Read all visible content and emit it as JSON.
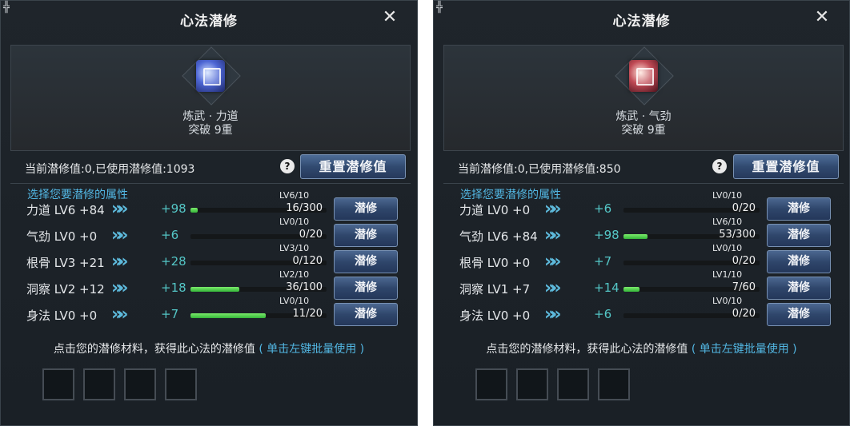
{
  "panels": [
    {
      "corner_glyph": "╬",
      "title": "心法潜修",
      "close_symbol": "✕",
      "skill_icon": "book-icon",
      "skill_icon_color": "#4d66d4",
      "skill_name": "炼武 · 力道",
      "skill_breakthrough": "突破 9重",
      "points_line": "当前潜修值:0,已使用潜修值:1093",
      "help_symbol": "?",
      "reset_label": "重置潜修值",
      "choose_label": "选择您要潜修的属性",
      "rows": [
        {
          "label": "力道 LV6 +84",
          "chevron": "»",
          "plus": "+98",
          "progress": "16/300",
          "level": "LV6/10",
          "fill": 0.053,
          "button": "潜修"
        },
        {
          "label": "气劲 LV0 +0",
          "chevron": "»",
          "plus": "+6",
          "progress": "0/20",
          "level": "LV0/10",
          "fill": 0.0,
          "button": "潜修"
        },
        {
          "label": "根骨 LV3 +21",
          "chevron": "»",
          "plus": "+28",
          "progress": "0/120",
          "level": "LV3/10",
          "fill": 0.0,
          "button": "潜修"
        },
        {
          "label": "洞察 LV2 +12",
          "chevron": "»",
          "plus": "+18",
          "progress": "36/100",
          "level": "LV2/10",
          "fill": 0.36,
          "button": "潜修"
        },
        {
          "label": "身法 LV0 +0",
          "chevron": "»",
          "plus": "+7",
          "progress": "11/20",
          "level": "LV0/10",
          "fill": 0.55,
          "button": "潜修"
        }
      ],
      "hint_text": "点击您的潜修材料，获得此心法的潜修值",
      "hint_link": "( 单击左键批量使用 )"
    },
    {
      "corner_glyph": "╬",
      "title": "心法潜修",
      "close_symbol": "✕",
      "skill_icon": "book-icon",
      "skill_icon_color": "#c04a55",
      "skill_name": "炼武 · 气劲",
      "skill_breakthrough": "突破 9重",
      "points_line": "当前潜修值:0,已使用潜修值:850",
      "help_symbol": "?",
      "reset_label": "重置潜修值",
      "choose_label": "选择您要潜修的属性",
      "rows": [
        {
          "label": "力道 LV0 +0",
          "chevron": "»",
          "plus": "+6",
          "progress": "0/20",
          "level": "LV0/10",
          "fill": 0.0,
          "button": "潜修"
        },
        {
          "label": "气劲 LV6 +84",
          "chevron": "»",
          "plus": "+98",
          "progress": "53/300",
          "level": "LV6/10",
          "fill": 0.177,
          "button": "潜修"
        },
        {
          "label": "根骨 LV0 +0",
          "chevron": "»",
          "plus": "+7",
          "progress": "0/20",
          "level": "LV0/10",
          "fill": 0.0,
          "button": "潜修"
        },
        {
          "label": "洞察 LV1 +7",
          "chevron": "»",
          "plus": "+14",
          "progress": "7/60",
          "level": "LV1/10",
          "fill": 0.117,
          "button": "潜修"
        },
        {
          "label": "身法 LV0 +0",
          "chevron": "»",
          "plus": "+6",
          "progress": "0/20",
          "level": "LV0/10",
          "fill": 0.0,
          "button": "潜修"
        }
      ],
      "hint_text": "点击您的潜修材料，获得此心法的潜修值",
      "hint_link": "( 单击左键批量使用 )"
    }
  ]
}
